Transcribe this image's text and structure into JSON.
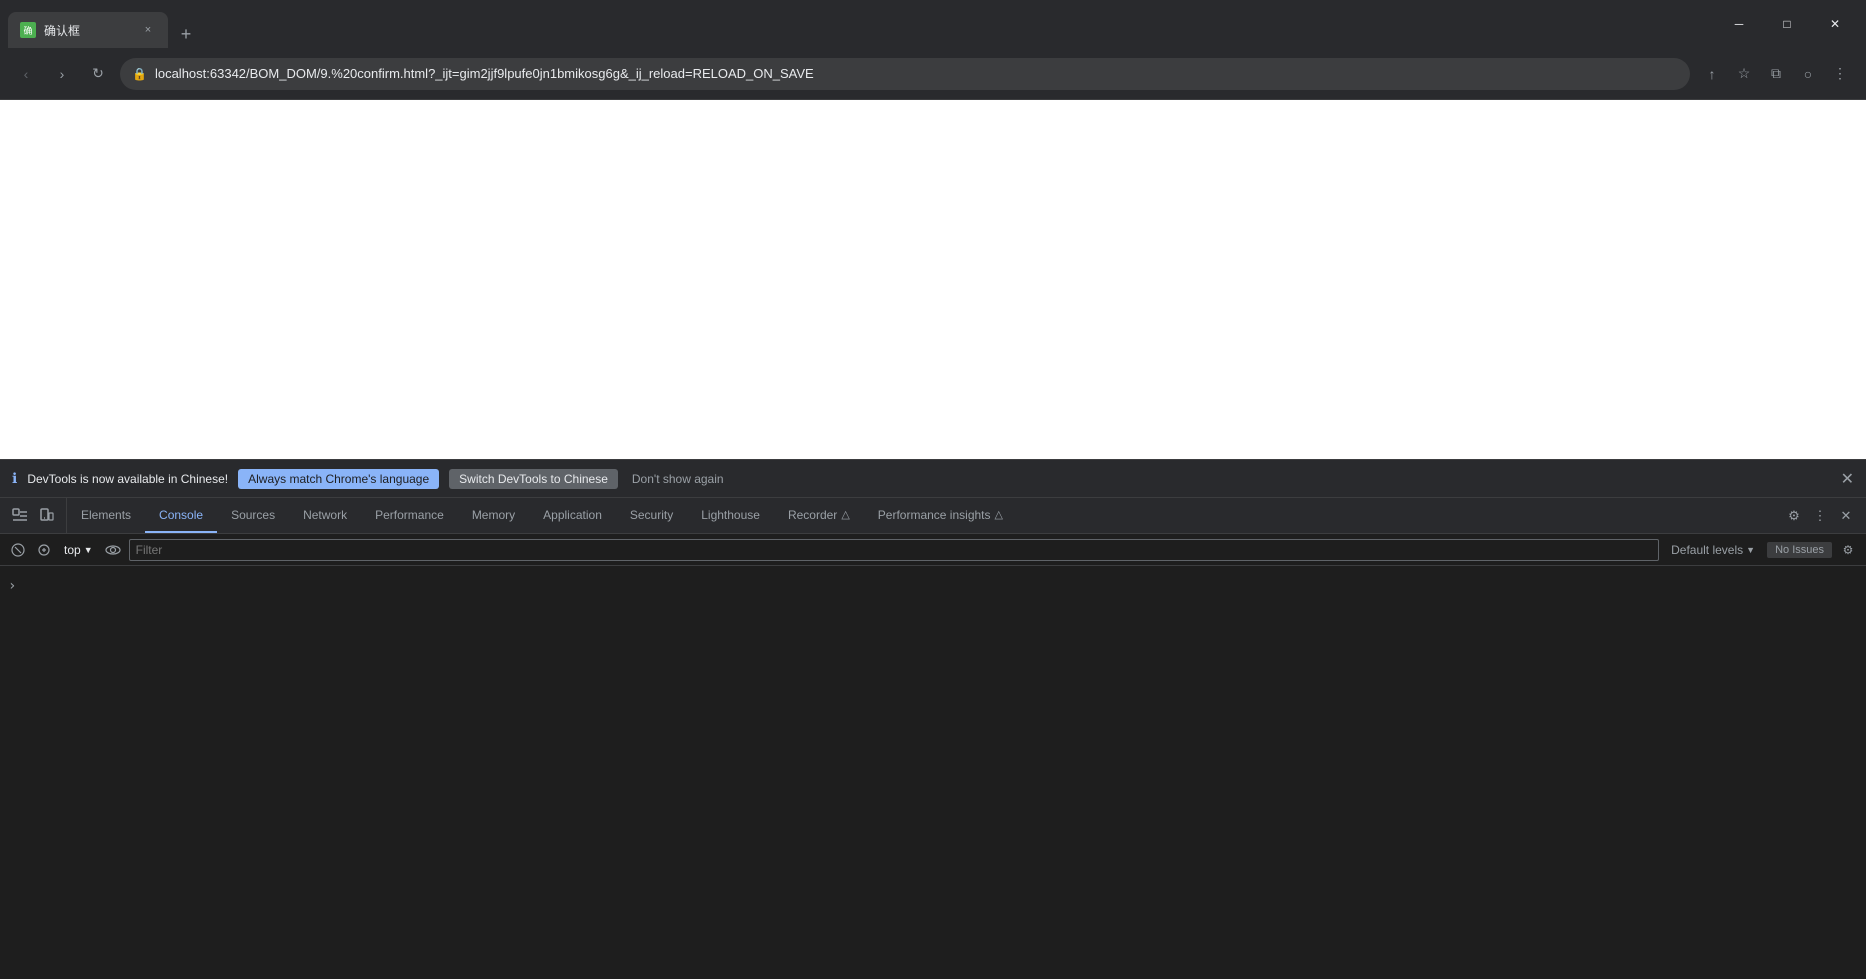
{
  "browser": {
    "tab": {
      "favicon_text": "确",
      "title": "确认框",
      "close_label": "×"
    },
    "new_tab_label": "+",
    "window_controls": {
      "minimize": "─",
      "maximize": "□",
      "close": "✕"
    },
    "nav": {
      "back_label": "‹",
      "forward_label": "›",
      "refresh_label": "↻",
      "url": "localhost:63342/BOM_DOM/9.%20confirm.html?_ijt=gim2jjf9lpufe0jn1bmikosg6g&_ij_reload=RELOAD_ON_SAVE",
      "share_icon": "↑",
      "star_icon": "☆",
      "split_icon": "⧉",
      "account_icon": "○",
      "menu_icon": "⋮"
    }
  },
  "devtools": {
    "notification": {
      "icon": "ℹ",
      "text": "DevTools is now available in Chinese!",
      "btn_match_label": "Always match Chrome's language",
      "btn_switch_label": "Switch DevTools to Chinese",
      "btn_dismiss_label": "Don't show again",
      "close_label": "✕"
    },
    "tabs": [
      {
        "id": "elements",
        "label": "Elements",
        "active": false
      },
      {
        "id": "console",
        "label": "Console",
        "active": true
      },
      {
        "id": "sources",
        "label": "Sources",
        "active": false
      },
      {
        "id": "network",
        "label": "Network",
        "active": false
      },
      {
        "id": "performance",
        "label": "Performance",
        "active": false
      },
      {
        "id": "memory",
        "label": "Memory",
        "active": false
      },
      {
        "id": "application",
        "label": "Application",
        "active": false
      },
      {
        "id": "security",
        "label": "Security",
        "active": false
      },
      {
        "id": "lighthouse",
        "label": "Lighthouse",
        "active": false
      },
      {
        "id": "recorder",
        "label": "Recorder",
        "active": false
      },
      {
        "id": "perf-insights",
        "label": "Performance insights",
        "active": false
      }
    ],
    "toolbar_icons": {
      "inspect": "⬚",
      "device": "▭",
      "settings": "⚙",
      "more": "⋮",
      "close": "✕"
    },
    "console": {
      "clear_icon": "🚫",
      "filter_placeholder": "Filter",
      "context": "top",
      "eye_icon": "👁",
      "default_levels_label": "Default levels",
      "no_issues_label": "No Issues",
      "settings_icon": "⚙"
    }
  }
}
